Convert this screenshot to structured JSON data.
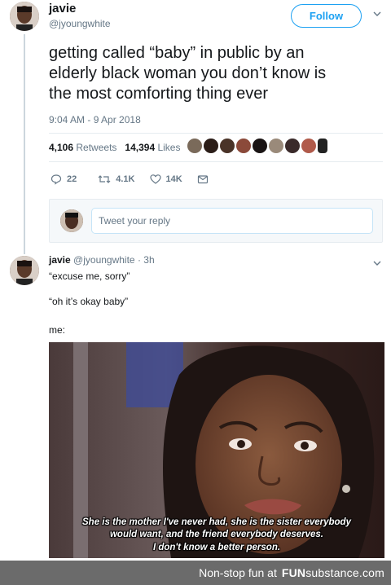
{
  "tweet": {
    "name": "javie",
    "handle": "@jyoungwhite",
    "follow_label": "Follow",
    "text_lines": [
      "getting called “baby” in public by an",
      "elderly black woman you don’t know is",
      "the most comforting thing ever"
    ],
    "timestamp": "9:04 AM - 9 Apr 2018",
    "retweets_count": "4,106",
    "retweets_label": "Retweets",
    "likes_count": "14,394",
    "likes_label": "Likes",
    "actions": {
      "replies": "22",
      "retweets": "4.1K",
      "likes": "14K"
    }
  },
  "reply_box": {
    "placeholder": "Tweet your reply"
  },
  "reply_tweet": {
    "name": "javie",
    "meta": "@jyoungwhite · 3h",
    "lines": [
      "“excuse me, sorry”",
      "“oh it’s okay baby”",
      "me:"
    ]
  },
  "meme": {
    "caption_lines": [
      "She is the mother I've never had, she is the sister everybody",
      "would want, and the friend everybody deserves.",
      "I don't know a better person."
    ]
  },
  "footer": {
    "tagline": "Non-stop fun at",
    "brand_prefix": "FUN",
    "brand_rest": "substance.com"
  },
  "colors": {
    "accent": "#1da1f2",
    "muted": "#657786",
    "footer_bg": "#6b6b6b"
  }
}
